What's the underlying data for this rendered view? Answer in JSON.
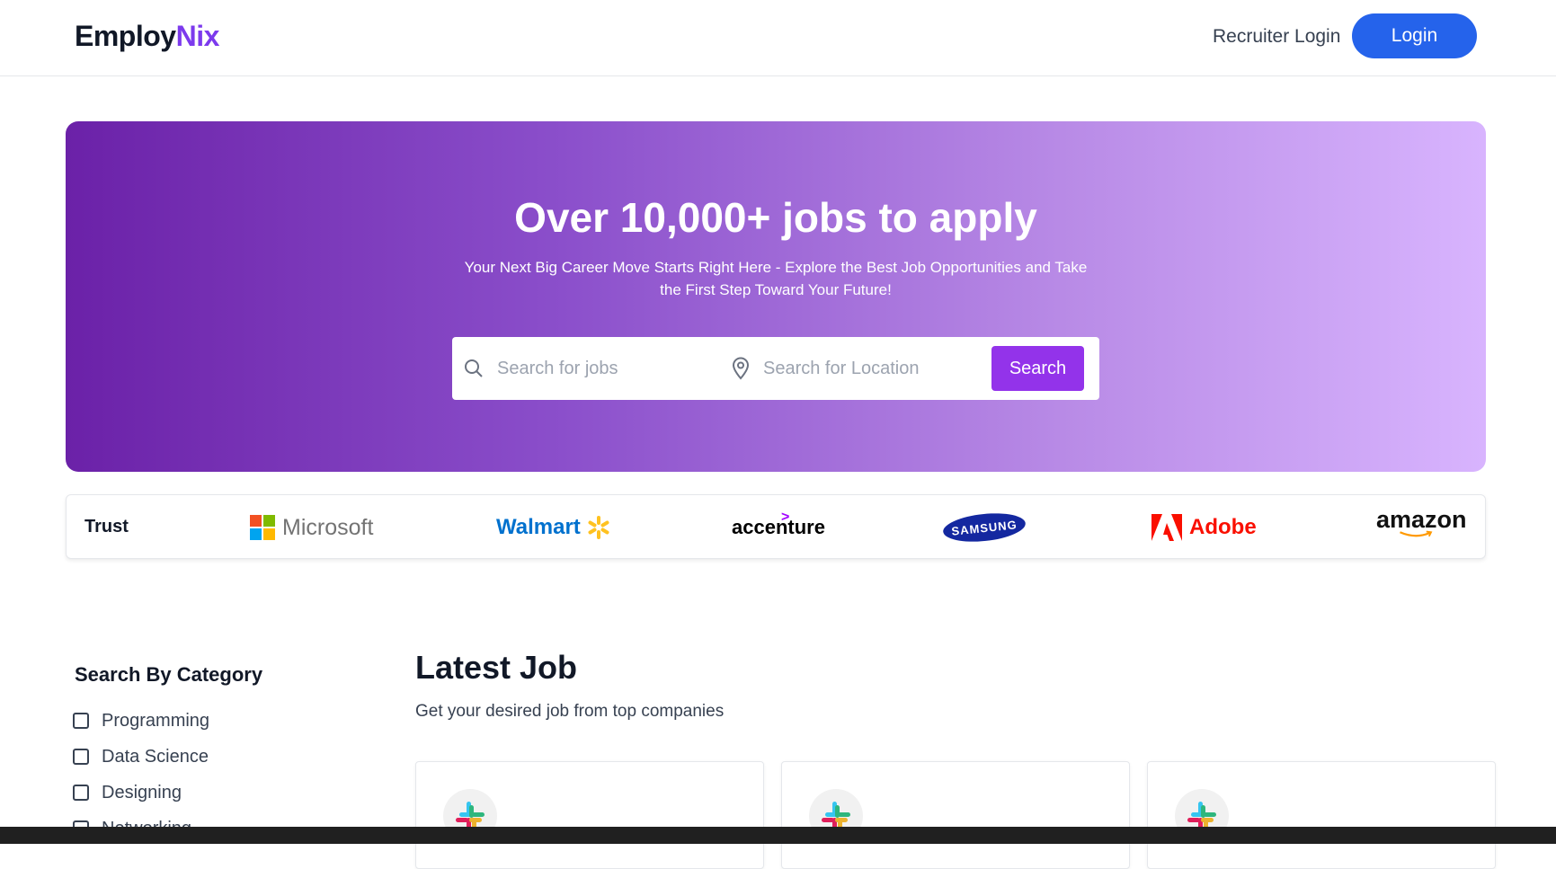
{
  "header": {
    "brand_main": "Employ",
    "brand_accent": "Nix",
    "recruiter_login": "Recruiter Login",
    "login": "Login"
  },
  "hero": {
    "title": "Over 10,000+ jobs to apply",
    "subtitle": "Your Next Big Career Move Starts Right Here - Explore the Best Job Opportunities and Take the First Step Toward Your Future!",
    "search": {
      "job_placeholder": "Search for jobs",
      "location_placeholder": "Search for Location",
      "button": "Search"
    }
  },
  "trust": {
    "label": "Trust",
    "companies": [
      "Microsoft",
      "Walmart",
      "accenture",
      "SAMSUNG",
      "Adobe",
      "amazon"
    ]
  },
  "categories": {
    "title": "Search By Category",
    "items": [
      "Programming",
      "Data Science",
      "Designing",
      "Networking"
    ]
  },
  "latest": {
    "title": "Latest Job",
    "subtitle": "Get your desired job from top companies"
  },
  "colors": {
    "brand_accent": "#7c3aed",
    "login_button": "#2563eb",
    "search_button": "#9333ea",
    "hero_start": "#6b21a8",
    "hero_end": "#d8b4fe"
  }
}
